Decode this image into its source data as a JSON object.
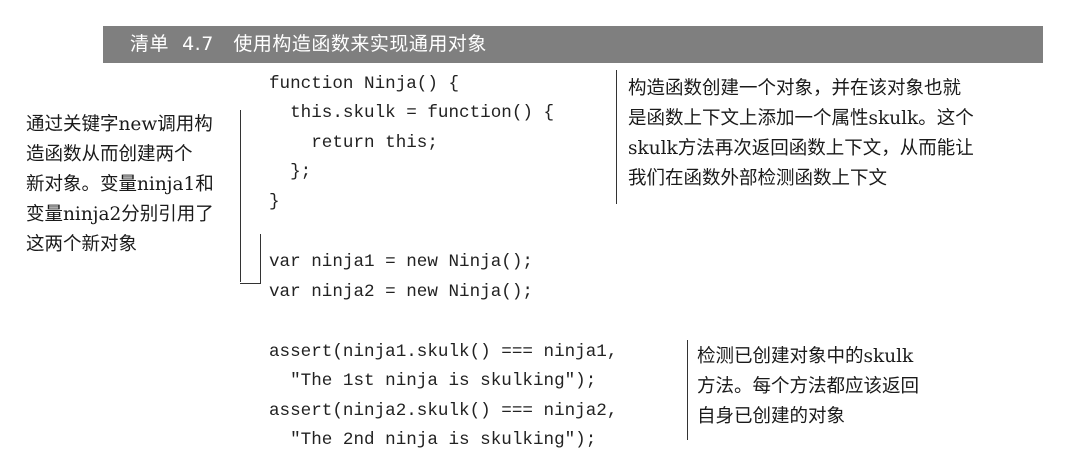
{
  "listing": {
    "title": "清单  4.7   使用构造函数来实现通用对象"
  },
  "code": {
    "lines": [
      "function Ninja() {",
      "  this.skulk = function() {",
      "    return this;",
      "  };",
      "}",
      "var ninja1 = new Ninja();",
      "var ninja2 = new Ninja();",
      "assert(ninja1.skulk() === ninja1,",
      "  \"The 1st ninja is skulking\");",
      "assert(ninja2.skulk() === ninja2,",
      "  \"The 2nd ninja is skulking\");"
    ]
  },
  "annotations": {
    "left": {
      "lines": [
        "通过关键字new调用构",
        "造函数从而创建两个",
        "新对象。变量ninja1和",
        "变量ninja2分别引用了",
        "这两个新对象"
      ]
    },
    "top_right": {
      "lines": [
        "构造函数创建一个对象，并在该对象也就",
        "是函数上下文上添加一个属性skulk。这个",
        "skulk方法再次返回函数上下文，从而能让",
        "我们在函数外部检测函数上下文"
      ]
    },
    "bottom_right": {
      "lines": [
        "检测已创建对象中的skulk",
        "方法。每个方法都应该返回",
        "自身已创建的对象"
      ]
    }
  }
}
